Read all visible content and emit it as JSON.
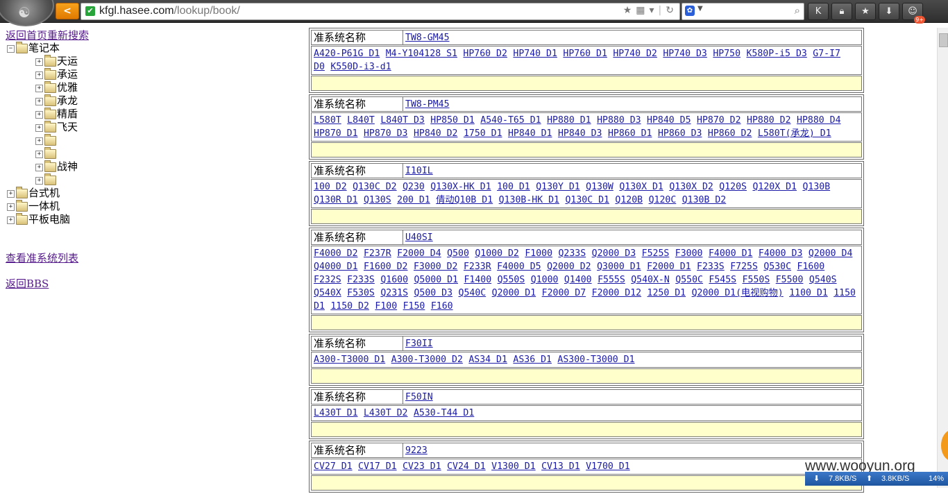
{
  "browser": {
    "url_domain": "kfgl.hasee.com",
    "url_path": "/lookup/book/",
    "back_label": "<"
  },
  "status": {
    "down": "7.8KB/S",
    "up": "3.8KB/S",
    "pct": "14%"
  },
  "watermark": "www.wooyun.org",
  "left": {
    "top_links": [
      "返回首页",
      "重新搜索"
    ],
    "tree": {
      "root": "笔记本",
      "children": [
        "天运",
        "承运",
        "优雅",
        "承龙",
        "精盾",
        "飞天",
        "",
        "",
        "战神",
        ""
      ],
      "others": [
        "台式机",
        "一体机",
        "平板电脑"
      ]
    },
    "view_list": "查看准系统列表",
    "back_bbs": "返回BBS"
  },
  "label": "准系统名称",
  "groups": [
    {
      "name": "TW8-GM45",
      "models": [
        "A420-P61G D1",
        "M4-Y104128 S1",
        "HP760 D2",
        "HP740 D1",
        "HP760 D1",
        "HP740 D2",
        "HP740 D3",
        "HP750",
        "K580P-i5 D3",
        "G7-I7 D0",
        "K550D-i3-d1"
      ]
    },
    {
      "name": "TW8-PM45",
      "models": [
        "L580T",
        "L840T",
        "L840T D3",
        "HP850 D1",
        "A540-T65 D1",
        "HP880 D1",
        "HP880 D3",
        "HP840 D5",
        "HP870 D2",
        "HP880 D2",
        "HP880 D4",
        "HP870 D1",
        "HP870 D3",
        "HP840 D2",
        "1750 D1",
        "HP840 D1",
        "HP840 D3",
        "HP860 D1",
        "HP860 D3",
        "HP860 D2",
        "L580T(承龙) D1"
      ]
    },
    {
      "name": "I10IL",
      "models": [
        "100 D2",
        "Q130C D2",
        "Q230",
        "Q130X-HK D1",
        "100 D1",
        "Q130Y D1",
        "Q130W",
        "Q130X D1",
        "Q130X D2",
        "Q120S",
        "Q120X D1",
        "Q130B",
        "Q130R D1",
        "Q130S",
        "200 D1",
        "倩动Q10B D1",
        "Q130B-HK D1",
        "Q130C D1",
        "Q120B",
        "Q120C",
        "Q130B D2"
      ]
    },
    {
      "name": "U40SI",
      "models": [
        "F4000 D2",
        "F237R",
        "F2000 D4",
        "Q500",
        "Q1000 D2",
        "F1000",
        "Q233S",
        "Q2000 D3",
        "F525S",
        "F3000",
        "F4000 D1",
        "F4000 D3",
        "Q2000 D4",
        "Q4000 D1",
        "F1600 D2",
        "F3000 D2",
        "F233R",
        "F4000 D5",
        "Q2000 D2",
        "Q3000 D1",
        "F2000 D1",
        "F233S",
        "F725S",
        "Q530C",
        "F1600",
        "F232S",
        "F233S",
        "Q1600",
        "Q5000 D1",
        "F1400",
        "Q550S",
        "Q1000",
        "Q1400",
        "F555S",
        "Q540X-N",
        "Q550C",
        "F545S",
        "F550S",
        "F5500",
        "Q540S",
        "Q540X",
        "F530S",
        "Q231S",
        "Q500 D3",
        "Q540C",
        "Q2000 D1",
        "F2000 D7",
        "F2000 D12",
        "1250 D1",
        "Q2000 D1(电视购物)",
        "1100 D1",
        "1150 D1",
        "1150 D2",
        "F100",
        "F150",
        "F160"
      ]
    },
    {
      "name": "F30II",
      "models": [
        "A300-T3000 D1",
        "A300-T3000 D2",
        "AS34 D1",
        "AS36 D1",
        "AS300-T3000 D1"
      ]
    },
    {
      "name": "F50IN",
      "models": [
        "L430T D1",
        "L430T D2",
        "A530-T44 D1"
      ]
    },
    {
      "name": "9223",
      "models": [
        "CV27 D1",
        "CV17 D1",
        "CV23 D1",
        "CV24 D1",
        "V1300 D1",
        "CV13 D1",
        "V1700 D1"
      ]
    }
  ]
}
